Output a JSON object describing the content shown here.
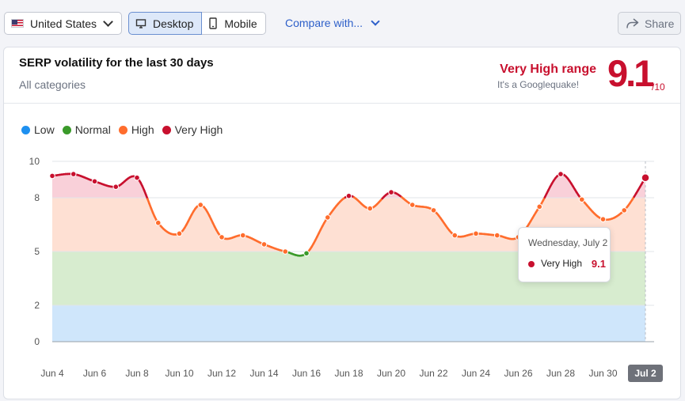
{
  "toolbar": {
    "country": "United States",
    "desktop_label": "Desktop",
    "mobile_label": "Mobile",
    "compare_label": "Compare with...",
    "share_label": "Share"
  },
  "card": {
    "title": "SERP volatility for the last 30 days",
    "subtitle": "All categories",
    "range_label": "Very High range",
    "range_sub": "It's a Googlequake!",
    "score": "9.1",
    "score_max": "/10"
  },
  "legend": [
    {
      "label": "Low",
      "color": "#1e90f0"
    },
    {
      "label": "Normal",
      "color": "#3a9a2a"
    },
    {
      "label": "High",
      "color": "#ff6d2d"
    },
    {
      "label": "Very High",
      "color": "#c8102e"
    }
  ],
  "tooltip": {
    "date": "Wednesday, July 2",
    "level": "Very High",
    "value": "9.1"
  },
  "chart_data": {
    "type": "area",
    "title": "SERP volatility for the last 30 days",
    "xlabel": "",
    "ylabel": "",
    "ylim": [
      0,
      10
    ],
    "ytick_labels": [
      "0",
      "2",
      "5",
      "8",
      "10"
    ],
    "bands": [
      {
        "name": "Low",
        "from": 0,
        "to": 2,
        "color": "#cfe6fb"
      },
      {
        "name": "Normal",
        "from": 2,
        "to": 5,
        "color": "#d7eccf"
      },
      {
        "name": "High",
        "from": 5,
        "to": 8,
        "color": "#fee0d3"
      },
      {
        "name": "Very High",
        "from": 8,
        "to": 10,
        "color": "#f9d0d9"
      }
    ],
    "x": [
      "Jun 4",
      "Jun 5",
      "Jun 6",
      "Jun 7",
      "Jun 8",
      "Jun 9",
      "Jun 10",
      "Jun 11",
      "Jun 12",
      "Jun 13",
      "Jun 14",
      "Jun 15",
      "Jun 16",
      "Jun 17",
      "Jun 18",
      "Jun 19",
      "Jun 20",
      "Jun 21",
      "Jun 22",
      "Jun 23",
      "Jun 24",
      "Jun 25",
      "Jun 26",
      "Jun 27",
      "Jun 28",
      "Jun 29",
      "Jun 30",
      "Jul 1",
      "Jul 2"
    ],
    "values": [
      9.2,
      9.3,
      8.9,
      8.6,
      9.1,
      6.6,
      6.0,
      7.6,
      5.8,
      5.9,
      5.4,
      5.0,
      4.9,
      6.9,
      8.1,
      7.4,
      8.3,
      7.6,
      7.3,
      5.9,
      6.0,
      5.9,
      5.8,
      7.5,
      9.3,
      7.9,
      6.8,
      7.3,
      9.1
    ],
    "x_tick_labels": [
      "Jun 4",
      "Jun 6",
      "Jun 8",
      "Jun 10",
      "Jun 12",
      "Jun 14",
      "Jun 16",
      "Jun 18",
      "Jun 20",
      "Jun 22",
      "Jun 24",
      "Jun 26",
      "Jun 28",
      "Jun 30",
      "Jul 2"
    ],
    "selected": "Jul 2",
    "grid": true
  }
}
